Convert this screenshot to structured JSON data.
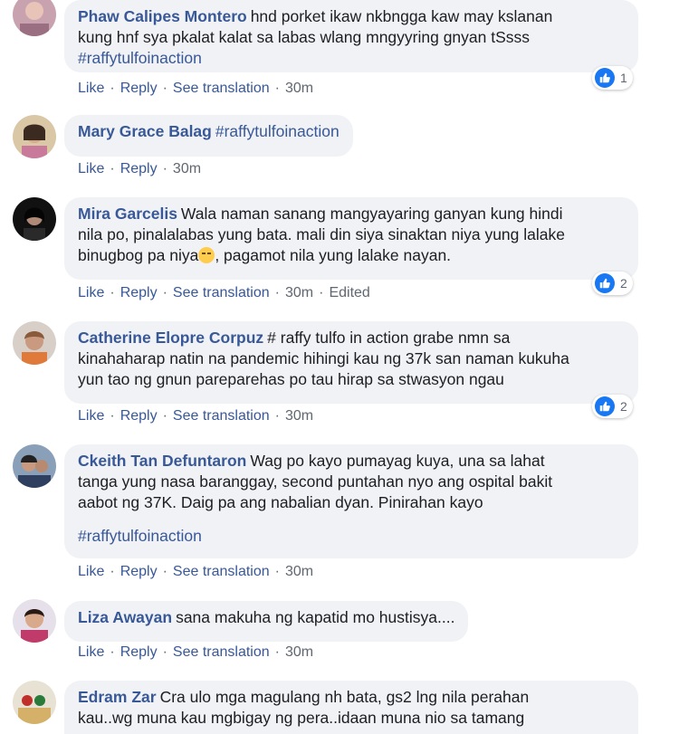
{
  "actions": {
    "like": "Like",
    "reply": "Reply",
    "see_translation": "See translation",
    "edited": "Edited"
  },
  "comments": [
    {
      "author": "Phaw Calipes Montero",
      "text": "hnd porket ikaw nkbngga kaw may kslanan\nkung hnf sya pkalat kalat sa labas wlang mngyyring gnyan tSsss",
      "hashtag": "#raffytulfoinaction",
      "time": "30m",
      "reactions": "1"
    },
    {
      "author": "Mary Grace Balag",
      "text": "#raffytulfoinaction",
      "time": "30m"
    },
    {
      "author": "Mira Garcelis",
      "text": "Wala naman sanang mangyayaring ganyan kung hindi\nnila po, pinalalabas yung bata. mali din siya sinaktan niya yung lalake\nbinugbog pa niya",
      "text_after": ", pagamot nila yung lalake nayan.",
      "time": "30m",
      "reactions": "2"
    },
    {
      "author": "Catherine Elopre Corpuz",
      "text": "# raffy tulfo in action grabe nmn sa\nkinahaharap natin na pandemic hihingi kau ng 37k san naman kukuha\nyun tao ng gnun pareparehas po tau hirap sa stwasyon ngau",
      "time": "30m",
      "reactions": "2"
    },
    {
      "author": "Ckeith Tan Defuntaron",
      "text": "Wag po kayo pumayag kuya, una sa lahat\ntanga yung nasa baranggay, second puntahan nyo ang ospital bakit\naabot ng 37K. Daig pa ang nabalian dyan. Pinirahan kayo",
      "hashtag": "#raffytulfoinaction",
      "time": "30m"
    },
    {
      "author": "Liza Awayan",
      "text": "sana makuha ng kapatid mo hustisya....",
      "time": "30m"
    },
    {
      "author": "Edram Zar",
      "text": "Cra ulo mga magulang nh bata, gs2 lng nila perahan\nkau..wg muna kau mgbigay ng pera..idaan muna nio sa tamang"
    }
  ]
}
